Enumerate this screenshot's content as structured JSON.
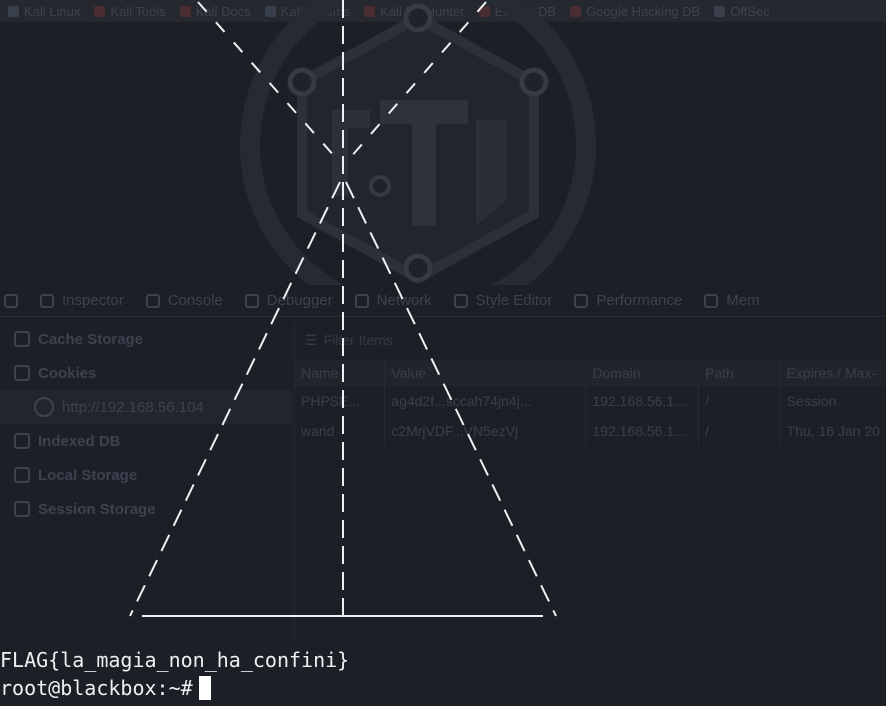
{
  "bookmarks": [
    {
      "label": "Kali Linux",
      "icon": "kali-icon"
    },
    {
      "label": "Kali Tools",
      "icon": "kali-tools-icon"
    },
    {
      "label": "Kali Docs",
      "icon": "kali-docs-icon"
    },
    {
      "label": "Kali Forums",
      "icon": "kali-forums-icon"
    },
    {
      "label": "Kali NetHunter",
      "icon": "nethunter-icon"
    },
    {
      "label": "Exploit-DB",
      "icon": "exploit-db-icon"
    },
    {
      "label": "Google Hacking DB",
      "icon": "ghdb-icon"
    },
    {
      "label": "OffSec",
      "icon": "offsec-icon"
    }
  ],
  "devtools": {
    "tabs": [
      "Inspector",
      "Console",
      "Debugger",
      "Network",
      "Style Editor",
      "Performance",
      "Mem"
    ]
  },
  "storage": {
    "items": [
      {
        "label": "Cache Storage"
      },
      {
        "label": "Cookies"
      },
      {
        "label": "http://192.168.56.104"
      },
      {
        "label": "Indexed DB"
      },
      {
        "label": "Local Storage"
      },
      {
        "label": "Session Storage"
      }
    ],
    "filter_placeholder": "Filter Items",
    "columns": [
      "Name",
      "Value",
      "Domain",
      "Path",
      "Expires / Max-"
    ],
    "rows": [
      [
        "PHPSE...",
        "ag4d2f...sccah74jn4j...",
        "192.168.56.1...",
        "/",
        "Session"
      ],
      [
        "wand",
        "c2MrjVDF...VN5ezVj",
        "192.168.56.1...",
        "/",
        "Thu, 16 Jan 20"
      ]
    ]
  },
  "terminal": {
    "flag_line": "FLAG{la_magia_non_ha_confini}",
    "prompt": "root@blackbox:~#"
  },
  "colors": {
    "terminal_bg": "#1d1f26",
    "terminal_fg": "#eef0f4",
    "faded_ui": "#3d4250"
  }
}
